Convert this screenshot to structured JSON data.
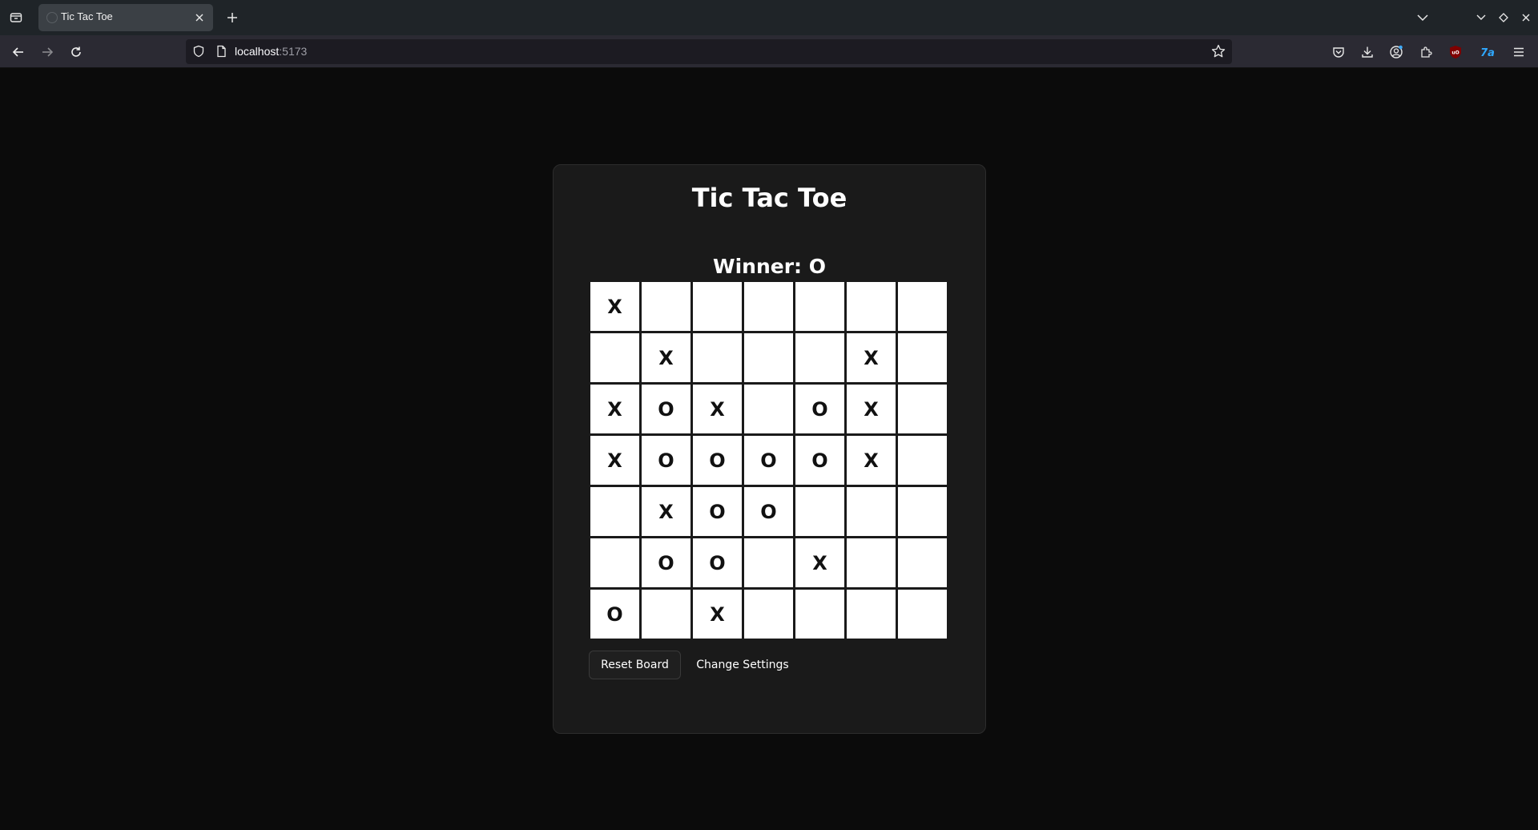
{
  "browser": {
    "tab_title": "Tic Tac Toe",
    "url_host": "localhost",
    "url_port": ":5173"
  },
  "app": {
    "title": "Tic Tac Toe",
    "status": "Winner: O",
    "board": [
      [
        "X",
        "",
        "",
        "",
        "",
        "",
        ""
      ],
      [
        "",
        "X",
        "",
        "",
        "",
        "X",
        ""
      ],
      [
        "X",
        "O",
        "X",
        "",
        "O",
        "X",
        ""
      ],
      [
        "X",
        "O",
        "O",
        "O",
        "O",
        "X",
        ""
      ],
      [
        "",
        "X",
        "O",
        "O",
        "",
        "",
        ""
      ],
      [
        "",
        "O",
        "O",
        "",
        "X",
        "",
        ""
      ],
      [
        "O",
        "",
        "X",
        "",
        "",
        "",
        ""
      ]
    ],
    "reset_label": "Reset Board",
    "settings_label": "Change Settings"
  },
  "colors": {
    "page_background": "#0b0b0b",
    "card_background": "#1a1a1a",
    "cell_background": "#ffffff"
  }
}
